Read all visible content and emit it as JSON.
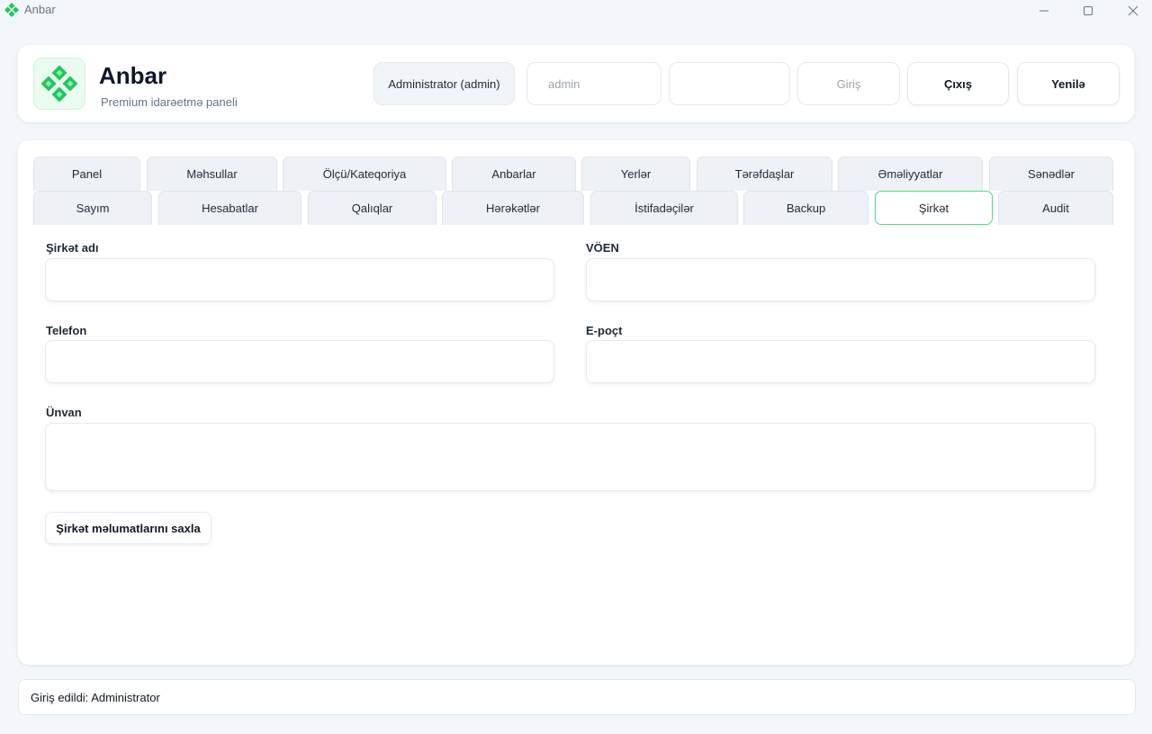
{
  "window": {
    "title": "Anbar"
  },
  "header": {
    "brand_title": "Anbar",
    "brand_subtitle": "Premium idarəetmə paneli",
    "role_label": "Administrator (admin)",
    "username_value": "admin",
    "password_value": "",
    "login_label": "Giriş",
    "logout_label": "Çıxış",
    "refresh_label": "Yenilə"
  },
  "tabs": {
    "row1": [
      {
        "label": "Panel"
      },
      {
        "label": "Məhsullar"
      },
      {
        "label": "Ölçü/Kateqoriya"
      },
      {
        "label": "Anbarlar"
      },
      {
        "label": "Yerlər"
      },
      {
        "label": "Tərəfdaşlar"
      },
      {
        "label": "Əməliyyatlar"
      },
      {
        "label": "Sənədlər"
      }
    ],
    "row2": [
      {
        "label": "Sayım"
      },
      {
        "label": "Hesabatlar"
      },
      {
        "label": "Qalıqlar"
      },
      {
        "label": "Hərəkətlər"
      },
      {
        "label": "İstifadəçilər"
      },
      {
        "label": "Backup"
      },
      {
        "label": "Şirkət"
      },
      {
        "label": "Audit"
      }
    ],
    "active": "Şirkət"
  },
  "form": {
    "company_name_label": "Şirkət adı",
    "company_name_value": "",
    "voen_label": "VÖEN",
    "voen_value": "",
    "phone_label": "Telefon",
    "phone_value": "",
    "email_label": "E-poçt",
    "email_value": "",
    "address_label": "Ünvan",
    "address_value": "",
    "save_label": "Şirkət məlumatlarını saxla"
  },
  "status": {
    "text": "Giriş edildi: Administrator"
  },
  "colors": {
    "accent": "#22c55e",
    "active_tab_border": "#4ade80"
  },
  "icons": {
    "app": "diamond-logo-icon",
    "minimize": "minimize-icon",
    "maximize": "maximize-icon",
    "close": "close-icon"
  }
}
